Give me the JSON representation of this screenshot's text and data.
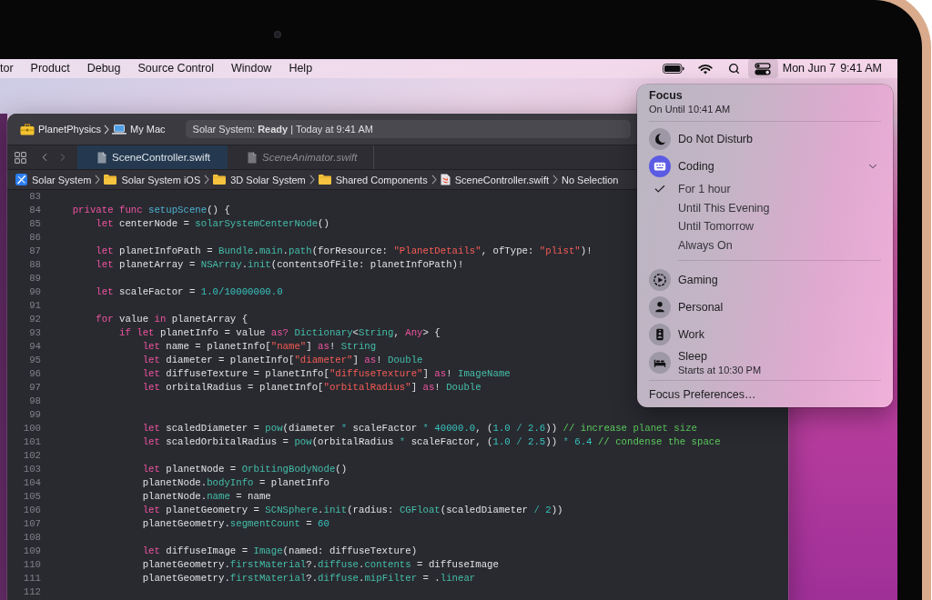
{
  "menu_bar": {
    "menus": [
      "tor",
      "Product",
      "Debug",
      "Source Control",
      "Window",
      "Help"
    ],
    "controls_selected": true,
    "date": "Mon Jun 7",
    "time": "9:41 AM"
  },
  "xcode": {
    "toolbar": {
      "scheme": "PlanetPhysics",
      "destination": "My Mac",
      "status": "Solar System: **Ready** | Today at 9:41 AM"
    },
    "tabs": [
      {
        "label": "SceneController.swift",
        "selected": true,
        "preview": false
      },
      {
        "label": "SceneAnimator.swift",
        "selected": false,
        "preview": true
      }
    ],
    "path": [
      {
        "label": "Solar System",
        "kind": "project"
      },
      {
        "label": "Solar System iOS",
        "kind": "folder"
      },
      {
        "label": "3D Solar System",
        "kind": "folder"
      },
      {
        "label": "Shared Components",
        "kind": "folder"
      },
      {
        "label": "SceneController.swift",
        "kind": "file"
      },
      {
        "label": "No Selection",
        "kind": "symbol"
      }
    ],
    "code": [
      {
        "number": "83"
      },
      {
        "number": "84",
        "tokens": [
          {
            "text": "    private ",
            "kind": "keyword"
          },
          {
            "text": "func ",
            "kind": "keyword"
          },
          {
            "text": "setupScene",
            "kind": "declaration"
          },
          {
            "text": "() {",
            "kind": "plain"
          }
        ]
      },
      {
        "number": "85",
        "tokens": [
          {
            "text": "        let",
            "kind": "keyword"
          },
          {
            "text": " centerNode = ",
            "kind": "plain"
          },
          {
            "text": "solarSystemCenterNode",
            "kind": "type"
          },
          {
            "text": "()",
            "kind": "plain"
          }
        ]
      },
      {
        "number": "86"
      },
      {
        "number": "87",
        "tokens": [
          {
            "text": "        let",
            "kind": "keyword"
          },
          {
            "text": " planetInfoPath = ",
            "kind": "plain"
          },
          {
            "text": "Bundle",
            "kind": "type"
          },
          {
            "text": ".",
            "kind": "plain"
          },
          {
            "text": "main",
            "kind": "type"
          },
          {
            "text": ".",
            "kind": "plain"
          },
          {
            "text": "path",
            "kind": "type"
          },
          {
            "text": "(forResource: ",
            "kind": "plain"
          },
          {
            "text": "\"PlanetDetails\"",
            "kind": "string"
          },
          {
            "text": ", ofType: ",
            "kind": "plain"
          },
          {
            "text": "\"plist\"",
            "kind": "string"
          },
          {
            "text": ")!",
            "kind": "plain"
          }
        ]
      },
      {
        "number": "88",
        "tokens": [
          {
            "text": "        let",
            "kind": "keyword"
          },
          {
            "text": " planetArray = ",
            "kind": "plain"
          },
          {
            "text": "NSArray",
            "kind": "type"
          },
          {
            "text": ".",
            "kind": "plain"
          },
          {
            "text": "init",
            "kind": "type"
          },
          {
            "text": "(contentsOfFile: planetInfoPath)!",
            "kind": "plain"
          }
        ]
      },
      {
        "number": "89"
      },
      {
        "number": "90",
        "tokens": [
          {
            "text": "        let",
            "kind": "keyword"
          },
          {
            "text": " scaleFactor = ",
            "kind": "plain"
          },
          {
            "text": "1.0/10000000.0",
            "kind": "number"
          }
        ]
      },
      {
        "number": "91"
      },
      {
        "number": "92",
        "tokens": [
          {
            "text": "        for",
            "kind": "keyword"
          },
          {
            "text": " value ",
            "kind": "plain"
          },
          {
            "text": "in",
            "kind": "keyword"
          },
          {
            "text": " planetArray {",
            "kind": "plain"
          }
        ]
      },
      {
        "number": "93",
        "tokens": [
          {
            "text": "            if ",
            "kind": "keyword"
          },
          {
            "text": "let",
            "kind": "keyword"
          },
          {
            "text": " planetInfo = value ",
            "kind": "plain"
          },
          {
            "text": "as? ",
            "kind": "keyword"
          },
          {
            "text": "Dictionary",
            "kind": "type"
          },
          {
            "text": "<",
            "kind": "plain"
          },
          {
            "text": "String",
            "kind": "type"
          },
          {
            "text": ", ",
            "kind": "plain"
          },
          {
            "text": "Any",
            "kind": "keyword"
          },
          {
            "text": "> {",
            "kind": "plain"
          }
        ]
      },
      {
        "number": "94",
        "tokens": [
          {
            "text": "                let",
            "kind": "keyword"
          },
          {
            "text": " name = planetInfo[",
            "kind": "plain"
          },
          {
            "text": "\"name\"",
            "kind": "string"
          },
          {
            "text": "] ",
            "kind": "plain"
          },
          {
            "text": "as",
            "kind": "keyword"
          },
          {
            "text": "! ",
            "kind": "plain"
          },
          {
            "text": "String",
            "kind": "type"
          }
        ]
      },
      {
        "number": "95",
        "tokens": [
          {
            "text": "                let",
            "kind": "keyword"
          },
          {
            "text": " diameter = planetInfo[",
            "kind": "plain"
          },
          {
            "text": "\"diameter\"",
            "kind": "string"
          },
          {
            "text": "] ",
            "kind": "plain"
          },
          {
            "text": "as",
            "kind": "keyword"
          },
          {
            "text": "! ",
            "kind": "plain"
          },
          {
            "text": "Double",
            "kind": "type"
          }
        ]
      },
      {
        "number": "96",
        "tokens": [
          {
            "text": "                let",
            "kind": "keyword"
          },
          {
            "text": " diffuseTexture = planetInfo[",
            "kind": "plain"
          },
          {
            "text": "\"diffuseTexture\"",
            "kind": "string"
          },
          {
            "text": "] ",
            "kind": "plain"
          },
          {
            "text": "as",
            "kind": "keyword"
          },
          {
            "text": "! ",
            "kind": "plain"
          },
          {
            "text": "ImageName",
            "kind": "type"
          }
        ]
      },
      {
        "number": "97",
        "tokens": [
          {
            "text": "                let",
            "kind": "keyword"
          },
          {
            "text": " orbitalRadius = planetInfo[",
            "kind": "plain"
          },
          {
            "text": "\"orbitalRadius\"",
            "kind": "string"
          },
          {
            "text": "] ",
            "kind": "plain"
          },
          {
            "text": "as",
            "kind": "keyword"
          },
          {
            "text": "! ",
            "kind": "plain"
          },
          {
            "text": "Double",
            "kind": "type"
          }
        ]
      },
      {
        "number": "98"
      },
      {
        "number": "99"
      },
      {
        "number": "100",
        "tokens": [
          {
            "text": "                let",
            "kind": "keyword"
          },
          {
            "text": " scaledDiameter = ",
            "kind": "plain"
          },
          {
            "text": "pow",
            "kind": "type"
          },
          {
            "text": "(diameter ",
            "kind": "plain"
          },
          {
            "text": "* ",
            "kind": "operator"
          },
          {
            "text": "scaleFactor ",
            "kind": "plain"
          },
          {
            "text": "* ",
            "kind": "operator"
          },
          {
            "text": "40000.0",
            "kind": "number"
          },
          {
            "text": ", (",
            "kind": "plain"
          },
          {
            "text": "1.0 ",
            "kind": "number"
          },
          {
            "text": "/ ",
            "kind": "operator"
          },
          {
            "text": "2.6",
            "kind": "number"
          },
          {
            "text": ")) ",
            "kind": "plain"
          },
          {
            "text": "// increase planet size",
            "kind": "comment"
          }
        ]
      },
      {
        "number": "101",
        "tokens": [
          {
            "text": "                let",
            "kind": "keyword"
          },
          {
            "text": " scaledOrbitalRadius = ",
            "kind": "plain"
          },
          {
            "text": "pow",
            "kind": "type"
          },
          {
            "text": "(orbitalRadius ",
            "kind": "plain"
          },
          {
            "text": "* ",
            "kind": "operator"
          },
          {
            "text": "scaleFactor, (",
            "kind": "plain"
          },
          {
            "text": "1.0 ",
            "kind": "number"
          },
          {
            "text": "/ ",
            "kind": "operator"
          },
          {
            "text": "2.5",
            "kind": "number"
          },
          {
            "text": ")) ",
            "kind": "plain"
          },
          {
            "text": "* ",
            "kind": "operator"
          },
          {
            "text": "6.4 ",
            "kind": "number"
          },
          {
            "text": "// condense the space",
            "kind": "comment"
          }
        ]
      },
      {
        "number": "102"
      },
      {
        "number": "103",
        "tokens": [
          {
            "text": "                let",
            "kind": "keyword"
          },
          {
            "text": " planetNode = ",
            "kind": "plain"
          },
          {
            "text": "OrbitingBodyNode",
            "kind": "type"
          },
          {
            "text": "()",
            "kind": "plain"
          }
        ]
      },
      {
        "number": "104",
        "tokens": [
          {
            "text": "                planetNode.",
            "kind": "plain"
          },
          {
            "text": "bodyInfo",
            "kind": "type"
          },
          {
            "text": " = planetInfo",
            "kind": "plain"
          }
        ]
      },
      {
        "number": "105",
        "tokens": [
          {
            "text": "                planetNode.",
            "kind": "plain"
          },
          {
            "text": "name",
            "kind": "type"
          },
          {
            "text": " = name",
            "kind": "plain"
          }
        ]
      },
      {
        "number": "106",
        "tokens": [
          {
            "text": "                let",
            "kind": "keyword"
          },
          {
            "text": " planetGeometry = ",
            "kind": "plain"
          },
          {
            "text": "SCNSphere",
            "kind": "type"
          },
          {
            "text": ".",
            "kind": "plain"
          },
          {
            "text": "init",
            "kind": "type"
          },
          {
            "text": "(radius: ",
            "kind": "plain"
          },
          {
            "text": "CGFloat",
            "kind": "type"
          },
          {
            "text": "(scaledDiameter ",
            "kind": "plain"
          },
          {
            "text": "/ ",
            "kind": "operator"
          },
          {
            "text": "2",
            "kind": "number"
          },
          {
            "text": "))",
            "kind": "plain"
          }
        ]
      },
      {
        "number": "107",
        "tokens": [
          {
            "text": "                planetGeometry.",
            "kind": "plain"
          },
          {
            "text": "segmentCount",
            "kind": "type"
          },
          {
            "text": " = ",
            "kind": "plain"
          },
          {
            "text": "60",
            "kind": "number"
          }
        ]
      },
      {
        "number": "108"
      },
      {
        "number": "109",
        "tokens": [
          {
            "text": "                let",
            "kind": "keyword"
          },
          {
            "text": " diffuseImage = ",
            "kind": "plain"
          },
          {
            "text": "Image",
            "kind": "type"
          },
          {
            "text": "(named: diffuseTexture)",
            "kind": "plain"
          }
        ]
      },
      {
        "number": "110",
        "tokens": [
          {
            "text": "                planetGeometry.",
            "kind": "plain"
          },
          {
            "text": "firstMaterial",
            "kind": "type"
          },
          {
            "text": "?.",
            "kind": "plain"
          },
          {
            "text": "diffuse",
            "kind": "type"
          },
          {
            "text": ".",
            "kind": "plain"
          },
          {
            "text": "contents",
            "kind": "type"
          },
          {
            "text": " = diffuseImage",
            "kind": "plain"
          }
        ]
      },
      {
        "number": "111",
        "tokens": [
          {
            "text": "                planetGeometry.",
            "kind": "plain"
          },
          {
            "text": "firstMaterial",
            "kind": "type"
          },
          {
            "text": "?.",
            "kind": "plain"
          },
          {
            "text": "diffuse",
            "kind": "type"
          },
          {
            "text": ".",
            "kind": "plain"
          },
          {
            "text": "mipFilter",
            "kind": "type"
          },
          {
            "text": " = .",
            "kind": "plain"
          },
          {
            "text": "linear",
            "kind": "type"
          }
        ]
      },
      {
        "number": "112"
      }
    ]
  },
  "focus_menu": {
    "title": "Focus",
    "subtitle": "On Until 10:41 AM",
    "modes": [
      {
        "label": "Do Not Disturb",
        "kind": "moon",
        "selected": false,
        "expanded": false
      },
      {
        "label": "Coding",
        "kind": "keyboard",
        "selected": true,
        "expanded": true,
        "options": [
          {
            "label": "For 1 hour",
            "selected": true
          },
          {
            "label": "Until This Evening",
            "selected": false
          },
          {
            "label": "Until Tomorrow",
            "selected": false
          },
          {
            "label": "Always On",
            "selected": false
          }
        ]
      },
      {
        "label": "Gaming",
        "kind": "play",
        "selected": false,
        "expanded": false
      },
      {
        "label": "Personal",
        "kind": "person",
        "selected": false,
        "expanded": false
      },
      {
        "label": "Work",
        "kind": "badge",
        "selected": false,
        "expanded": false
      },
      {
        "label": "Sleep",
        "kind": "bed",
        "selected": false,
        "expanded": false,
        "detail": "Starts at 10:30 PM"
      }
    ],
    "preferences": "Focus Preferences…"
  }
}
